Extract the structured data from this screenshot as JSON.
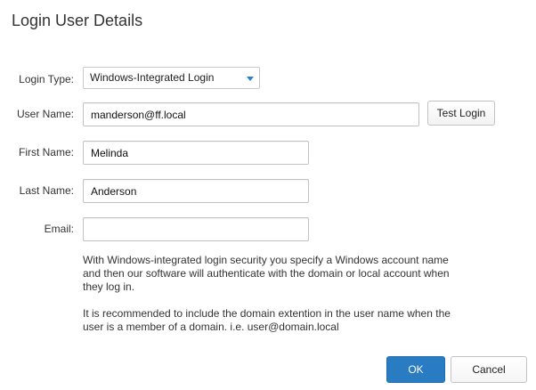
{
  "dialog": {
    "title": "Login User Details"
  },
  "form": {
    "login_type": {
      "label": "Login Type:",
      "value": "Windows-Integrated Login"
    },
    "user_name": {
      "label": "User Name:",
      "value": "manderson@ff.local"
    },
    "first_name": {
      "label": "First Name:",
      "value": "Melinda"
    },
    "last_name": {
      "label": "Last Name:",
      "value": "Anderson"
    },
    "email": {
      "label": "Email:",
      "value": ""
    }
  },
  "buttons": {
    "test_login": "Test Login",
    "ok": "OK",
    "cancel": "Cancel"
  },
  "help": {
    "paragraph1": "With Windows-integrated login security you specify a Windows account name and then our software will authenticate with the domain or local account when they log in.",
    "paragraph2": "It is recommended to include the domain extention in the user name when the user is a member of a domain. i.e. user@domain.local"
  },
  "colors": {
    "accent": "#2a7cc2",
    "caret": "#2e7fc6"
  },
  "icons": {
    "dropdown": "chevron-down-icon"
  }
}
